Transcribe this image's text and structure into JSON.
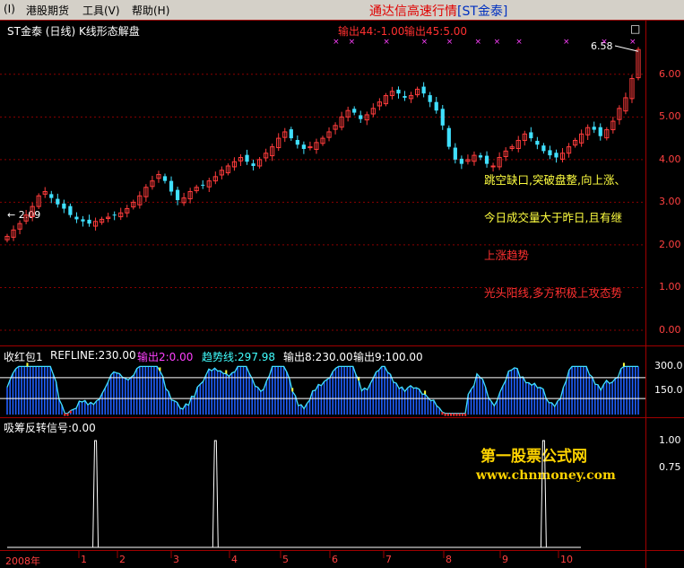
{
  "menu": {
    "sys": "(I)",
    "hk": "港股期货",
    "tools": "工具(V)",
    "help": "帮助(H)"
  },
  "window": {
    "title_text": "通达信高速行情",
    "title_symbol": "[ST金泰]",
    "close_button": "□"
  },
  "main_panel": {
    "header": "ST金泰 (日线) K线形态解盘",
    "out44": "输出44:-1.00",
    "out45": "输出45:5.00",
    "high_label": "6.58",
    "low_label": "← 2.09",
    "messages": {
      "m1": "跳空缺口,突破盘整,向上涨、",
      "m2": "今日成交量大于昨日,且有继",
      "m3": "上涨趋势",
      "m4": "光头阳线,多方积极上攻态势"
    }
  },
  "ind_panel": {
    "name": "收红包1",
    "refline": "REFLINE:230.00",
    "out2": "输出2:0.00",
    "trend": "趋势线:297.98",
    "out8": "输出8:230.00",
    "out9": "输出9:100.00"
  },
  "sig_panel": {
    "name": "吸筹反转",
    "signal": "信号:0.00"
  },
  "watermark": {
    "cn": "第一股票公式网",
    "url": "www.chnmoney.com"
  },
  "axis": {
    "main_y": [
      {
        "v": 6.0,
        "label": "6.00"
      },
      {
        "v": 5.0,
        "label": "5.00"
      },
      {
        "v": 4.0,
        "label": "4.00"
      },
      {
        "v": 3.0,
        "label": "3.00"
      },
      {
        "v": 2.0,
        "label": "2.00"
      },
      {
        "v": 1.0,
        "label": "1.00"
      },
      {
        "v": 0.0,
        "label": "0.00"
      }
    ],
    "ind_y": [
      {
        "v": 300,
        "label": "300.0"
      },
      {
        "v": 150,
        "label": "150.0"
      }
    ],
    "sig_y": [
      {
        "v": 1.0,
        "label": "1.00"
      },
      {
        "v": 0.75,
        "label": "0.75"
      }
    ],
    "x": [
      "2008年",
      "1",
      "2",
      "3",
      "4",
      "5",
      "6",
      "7",
      "8",
      "9",
      "10"
    ]
  },
  "chart_data": {
    "type": "candlestick",
    "price_range": [
      0,
      6.9
    ],
    "closes": [
      2.2,
      2.35,
      2.5,
      2.7,
      2.9,
      3.15,
      3.25,
      3.1,
      2.95,
      2.85,
      2.7,
      2.6,
      2.55,
      2.5,
      2.55,
      2.6,
      2.65,
      2.7,
      2.75,
      2.85,
      3.0,
      3.15,
      3.35,
      3.5,
      3.65,
      3.5,
      3.25,
      3.05,
      3.1,
      3.25,
      3.35,
      3.4,
      3.5,
      3.6,
      3.75,
      3.85,
      3.95,
      4.05,
      3.95,
      3.85,
      4.0,
      4.15,
      4.3,
      4.5,
      4.65,
      4.5,
      4.35,
      4.25,
      4.3,
      4.4,
      4.5,
      4.65,
      4.8,
      5.0,
      5.15,
      5.1,
      4.95,
      5.05,
      5.2,
      5.35,
      5.5,
      5.6,
      5.55,
      5.45,
      5.5,
      5.65,
      5.55,
      5.35,
      5.15,
      4.8,
      4.3,
      4.0,
      3.9,
      4.0,
      4.1,
      4.05,
      3.9,
      3.85,
      4.05,
      4.2,
      4.3,
      4.45,
      4.6,
      4.5,
      4.35,
      4.2,
      4.1,
      4.05,
      4.15,
      4.3,
      4.45,
      4.6,
      4.75,
      4.7,
      4.55,
      4.7,
      4.9,
      5.2,
      5.45,
      5.9,
      6.58
    ],
    "indicator_levels": {
      "upper": 230,
      "middle": 100
    },
    "indicator_range": [
      0,
      330
    ],
    "signal_spikes_at_index": [
      14,
      33,
      85
    ],
    "signal_range": [
      0,
      1.05
    ]
  }
}
